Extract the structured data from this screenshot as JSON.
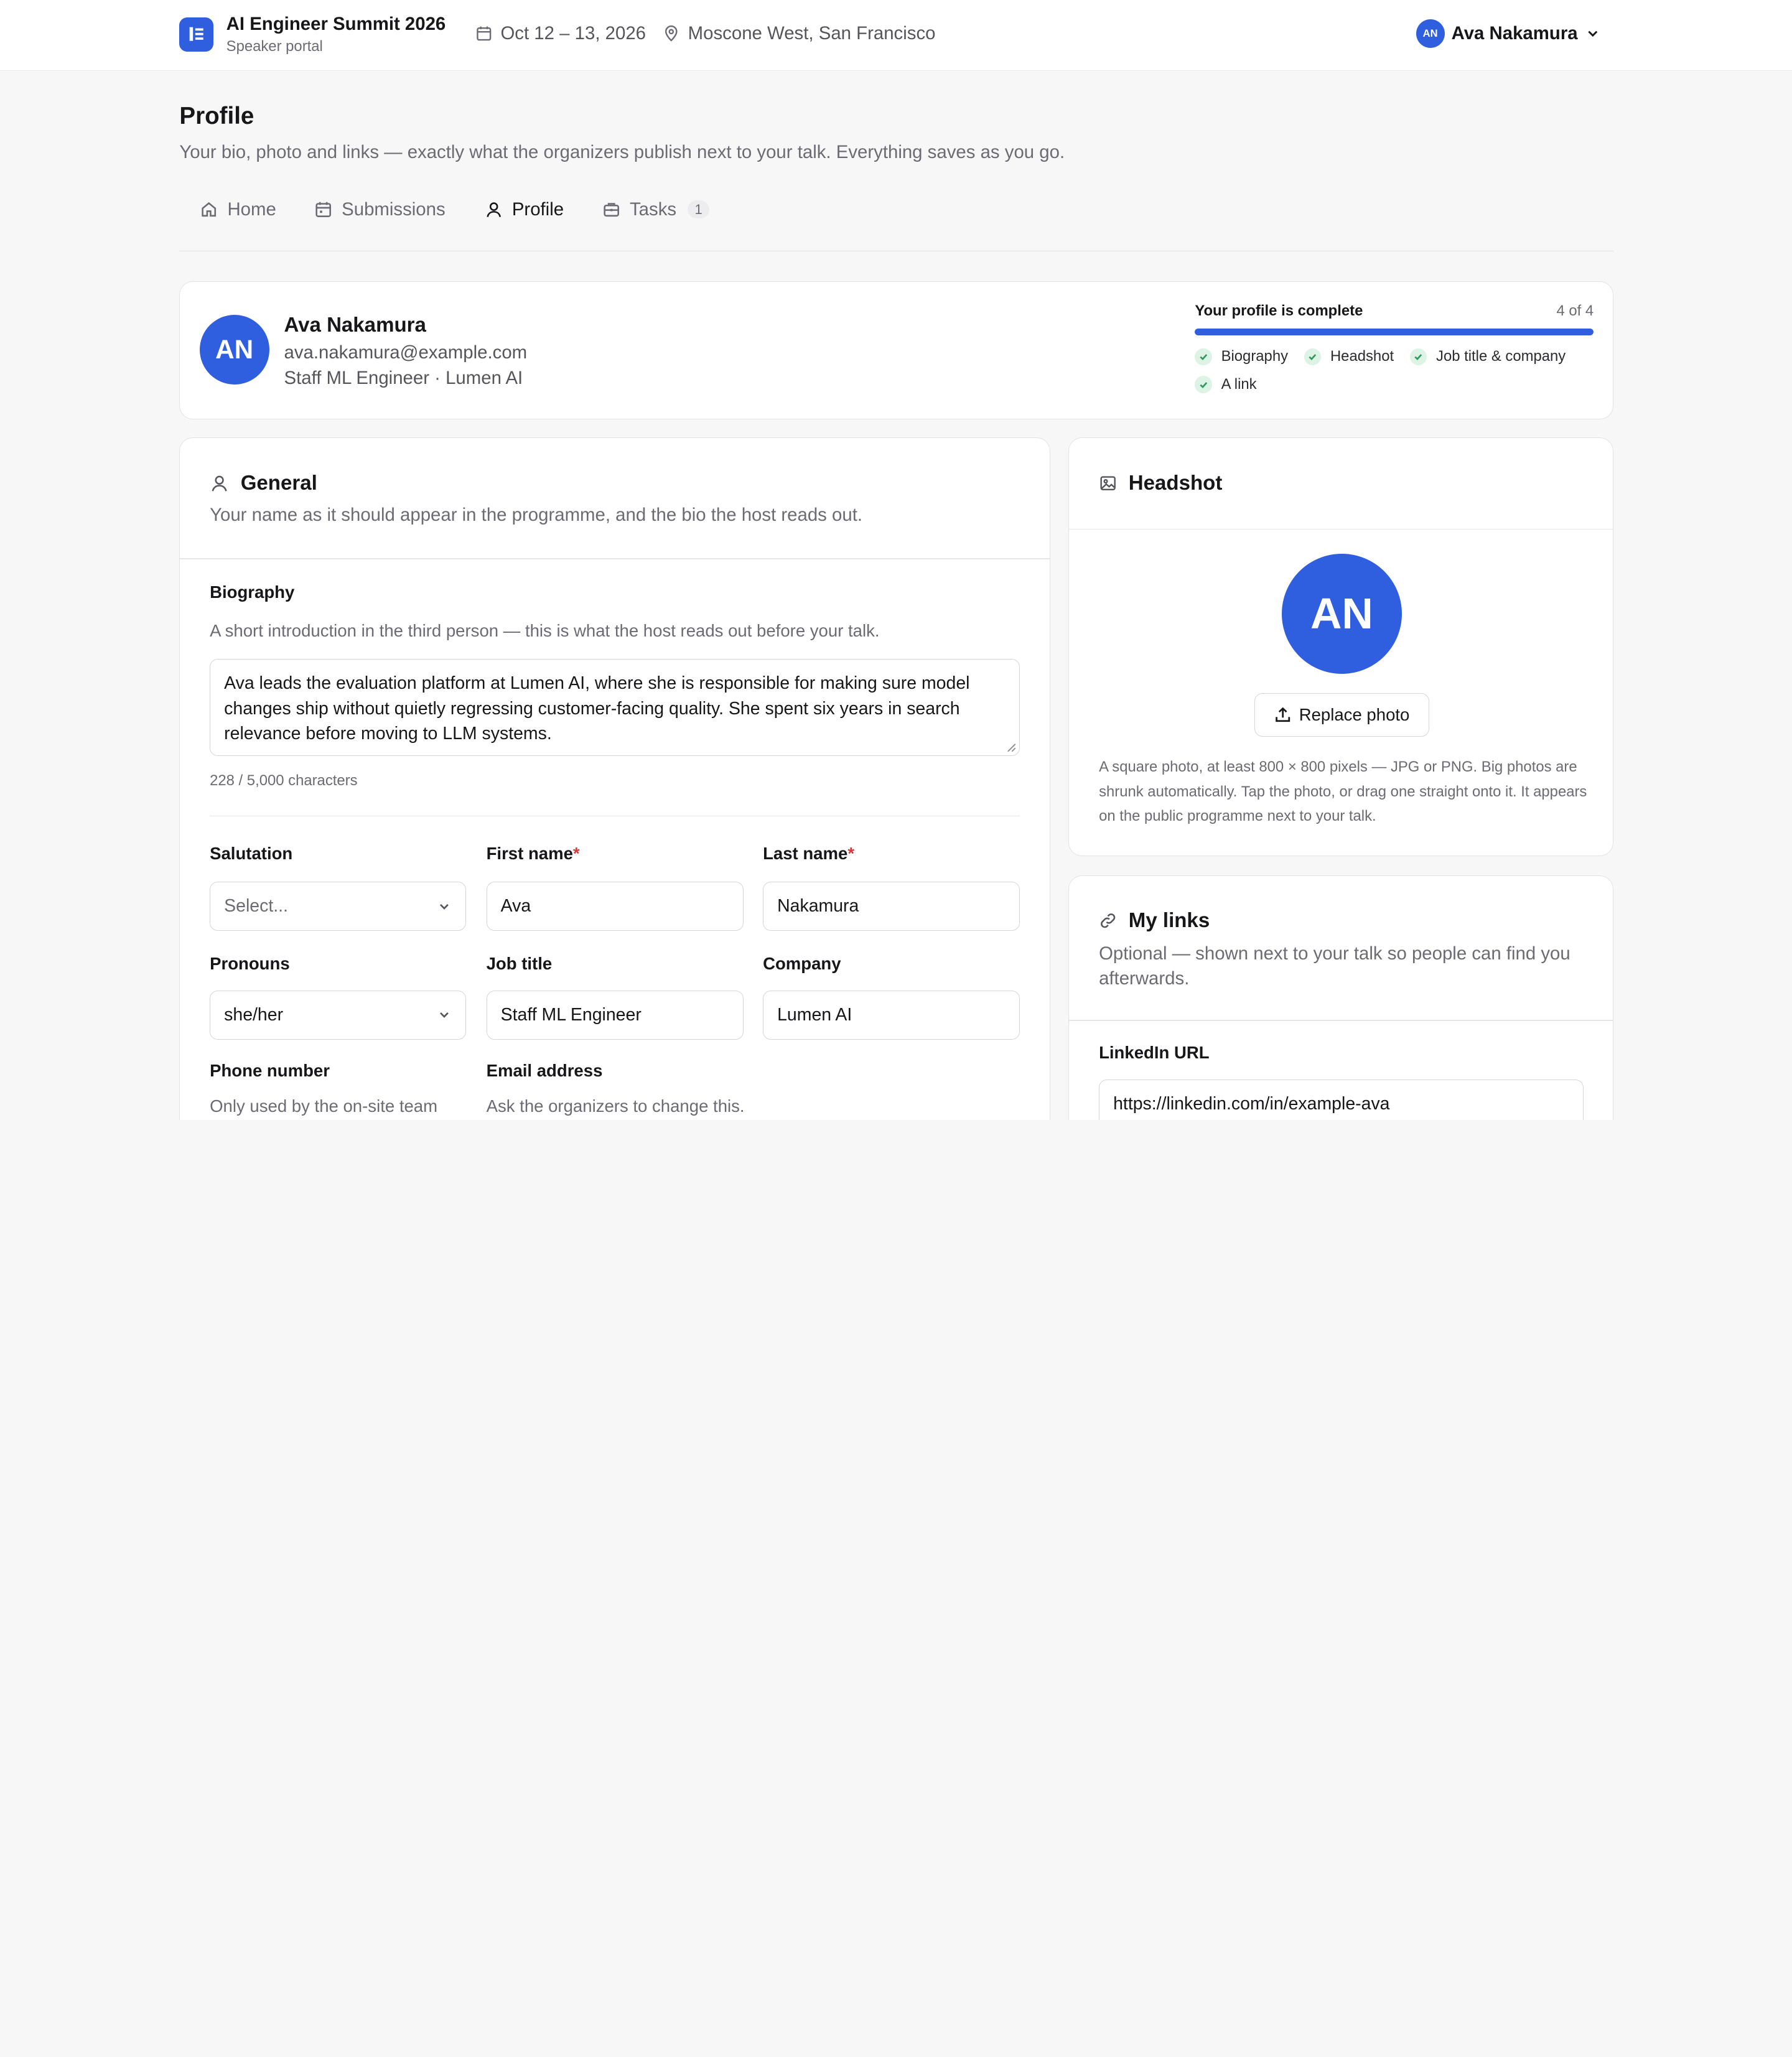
{
  "header": {
    "event_title": "AI Engineer Summit 2026",
    "portal_label": "Speaker portal",
    "dates": "Oct 12 – 13, 2026",
    "location": "Moscone West, San Francisco",
    "user_initials": "AN",
    "user_name": "Ava Nakamura"
  },
  "page": {
    "title": "Profile",
    "subtitle": "Your bio, photo and links — exactly what the organizers publish next to your talk. Everything saves as you go."
  },
  "tabs": [
    {
      "label": "Home",
      "icon": "home-icon"
    },
    {
      "label": "Submissions",
      "icon": "calendar-icon"
    },
    {
      "label": "Profile",
      "icon": "user-icon",
      "active": true
    },
    {
      "label": "Tasks",
      "icon": "briefcase-icon",
      "count": "1"
    }
  ],
  "profile_card": {
    "initials": "AN",
    "name": "Ava Nakamura",
    "email": "ava.nakamura@example.com",
    "role": "Staff ML Engineer · Lumen AI",
    "progress_title": "Your profile is complete",
    "progress_count": "4 of 4",
    "progress_fraction": 1.0,
    "checklist": [
      "Biography",
      "Headshot",
      "Job title & company",
      "A link"
    ]
  },
  "general": {
    "title": "General",
    "description": "Your name as it should appear in the programme, and the bio the host reads out.",
    "bio_label": "Biography",
    "bio_help": "A short introduction in the third person — this is what the host reads out before your talk.",
    "bio_value": "Ava leads the evaluation platform at Lumen AI, where she is responsible for making sure model changes ship without quietly regressing customer-facing quality. She spent six years in search relevance before moving to LLM systems.",
    "bio_count": "228 / 5,000 characters",
    "salutation_label": "Salutation",
    "salutation_placeholder": "Select...",
    "first_name_label": "First name",
    "first_name_value": "Ava",
    "last_name_label": "Last name",
    "last_name_value": "Nakamura",
    "required_mark": "*",
    "pronouns_label": "Pronouns",
    "pronouns_value": "she/her",
    "job_title_label": "Job title",
    "job_title_value": "Staff ML Engineer",
    "company_label": "Company",
    "company_value": "Lumen AI",
    "phone_label": "Phone number",
    "phone_help": "Only used by the on-site team",
    "email_label": "Email address",
    "email_help": "Ask the organizers to change this."
  },
  "headshot": {
    "title": "Headshot",
    "initials": "AN",
    "button_label": "Replace photo",
    "help": "A square photo, at least 800 × 800 pixels — JPG or PNG. Big photos are shrunk automatically. Tap the photo, or drag one straight onto it. It appears on the public programme next to your talk."
  },
  "links": {
    "title": "My links",
    "description": "Optional — shown next to your talk so people can find you afterwards.",
    "linkedin_label": "LinkedIn URL",
    "linkedin_value": "https://linkedin.com/in/example-ava"
  },
  "colors": {
    "accent": "#2f5fdf",
    "success_bg": "#dcf3e6",
    "success_check": "#2e9a5e",
    "required": "#d63b3b"
  }
}
